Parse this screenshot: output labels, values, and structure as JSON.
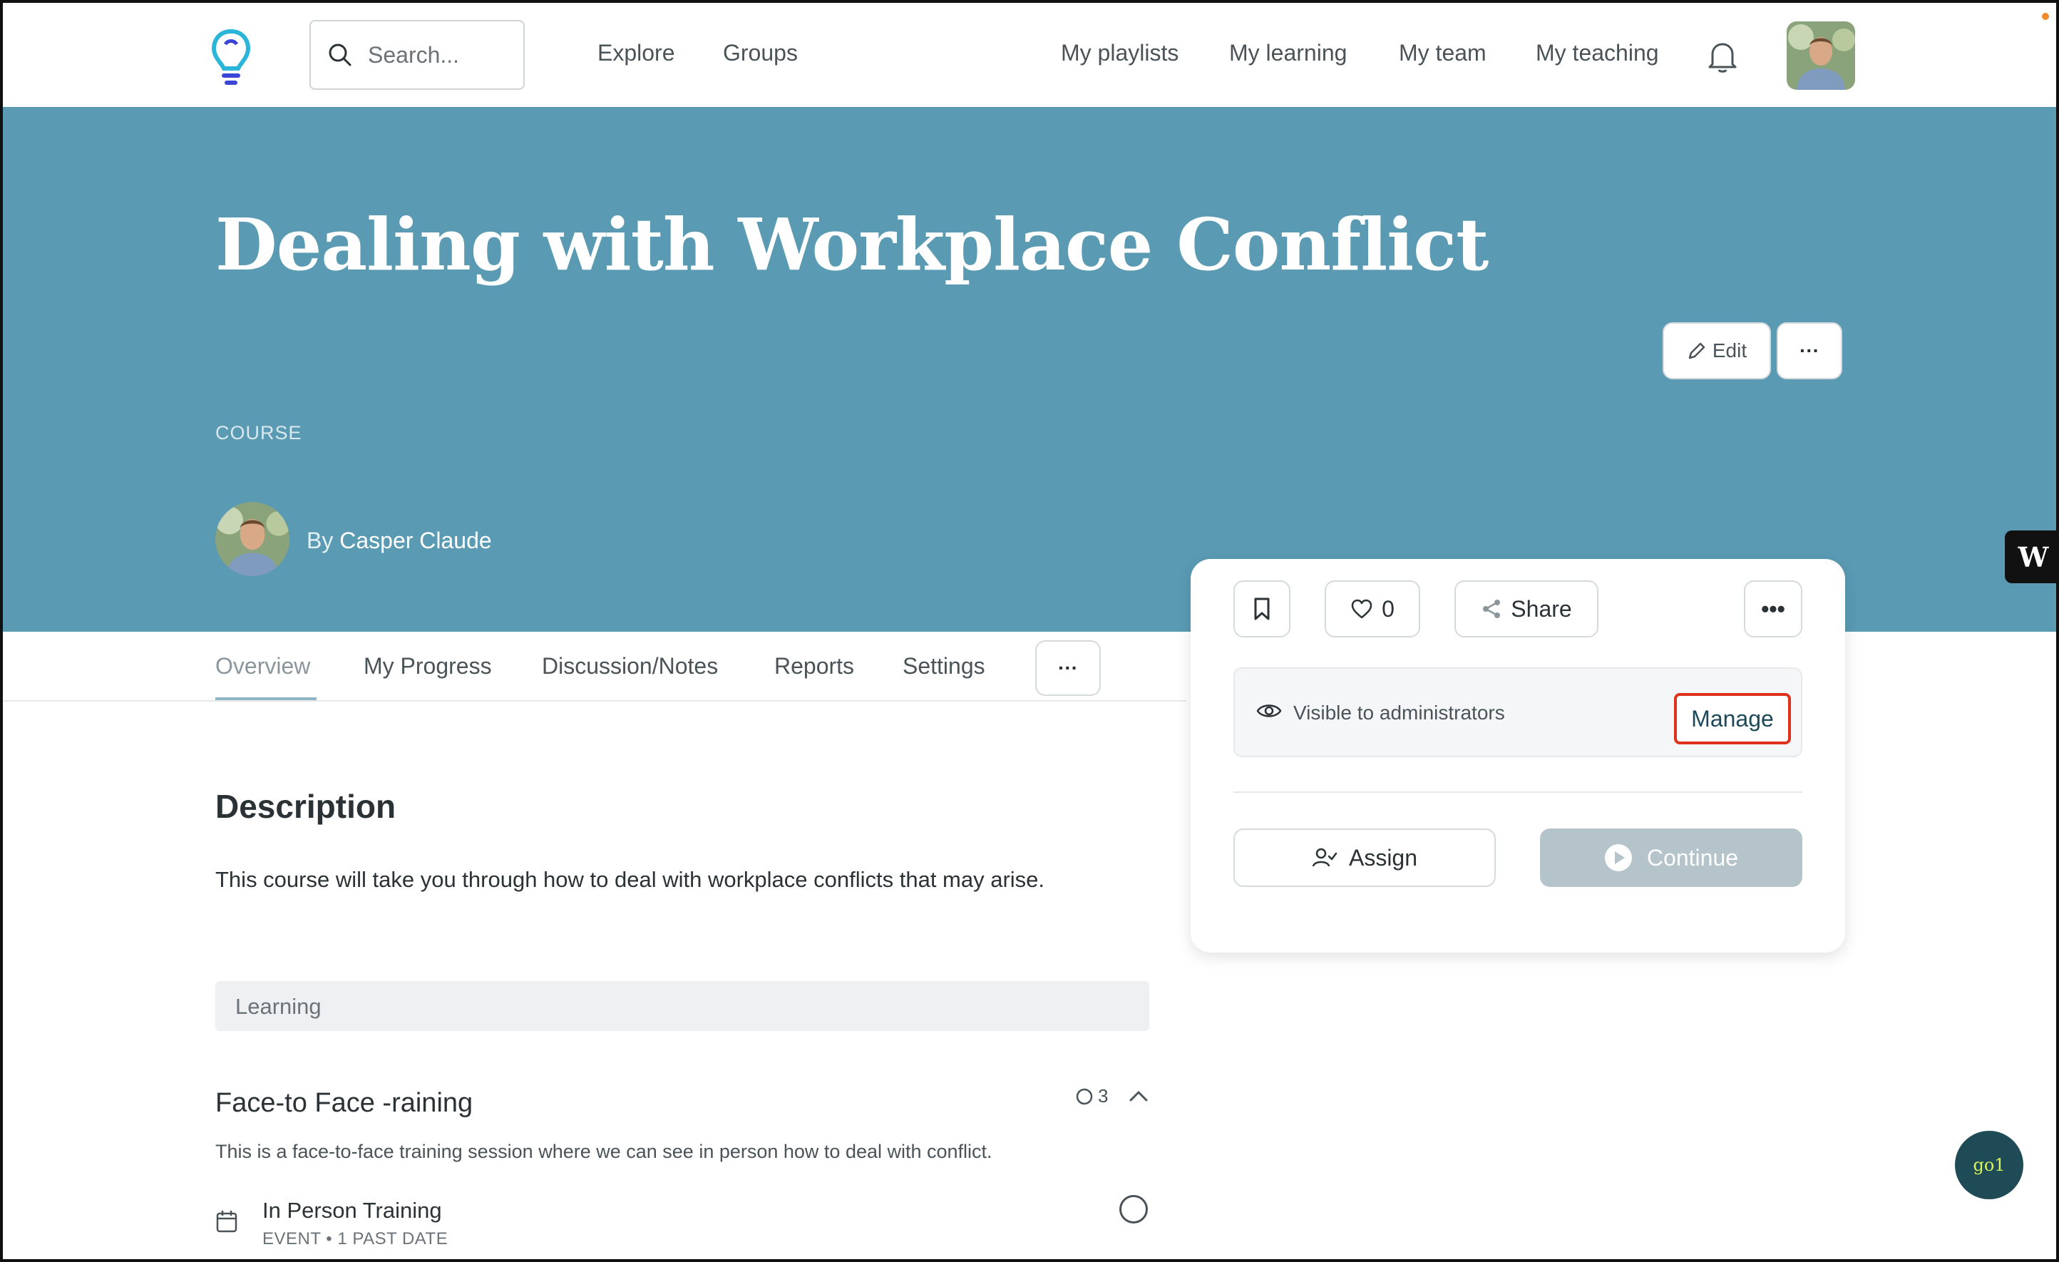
{
  "header": {
    "search_placeholder": "Search...",
    "nav_left": [
      "Explore",
      "Groups"
    ],
    "nav_right": [
      "My playlists",
      "My learning",
      "My team",
      "My teaching"
    ]
  },
  "hero": {
    "title": "Dealing with Workplace Conflict",
    "type": "COURSE",
    "author_prefix": "By",
    "author_name": "Casper Claude",
    "edit_label": "Edit",
    "more_label": "···",
    "badge": "W",
    "background_color": "#5a9bb3"
  },
  "tabs": {
    "items": [
      "Overview",
      "My Progress",
      "Discussion/Notes",
      "Reports",
      "Settings"
    ],
    "active": "Overview",
    "more_label": "···"
  },
  "content": {
    "description_heading": "Description",
    "description_text": "This course will take you through how to deal with workplace conflicts that may arise.",
    "learning_label": "Learning",
    "section": {
      "title": "Face-to Face -raining",
      "count": "3",
      "description": "This is a face-to-face training session where we can see in person how to deal with conflict.",
      "item_title": "In Person Training",
      "item_meta": "EVENT • 1 PAST DATE"
    }
  },
  "card": {
    "like_count": "0",
    "share_label": "Share",
    "more_label": "•••",
    "visibility_text": "Visible to administrators",
    "manage_label": "Manage",
    "assign_label": "Assign",
    "continue_label": "Continue",
    "highlight_color": "#e0311d"
  },
  "widget": {
    "go1_label": "go1"
  }
}
